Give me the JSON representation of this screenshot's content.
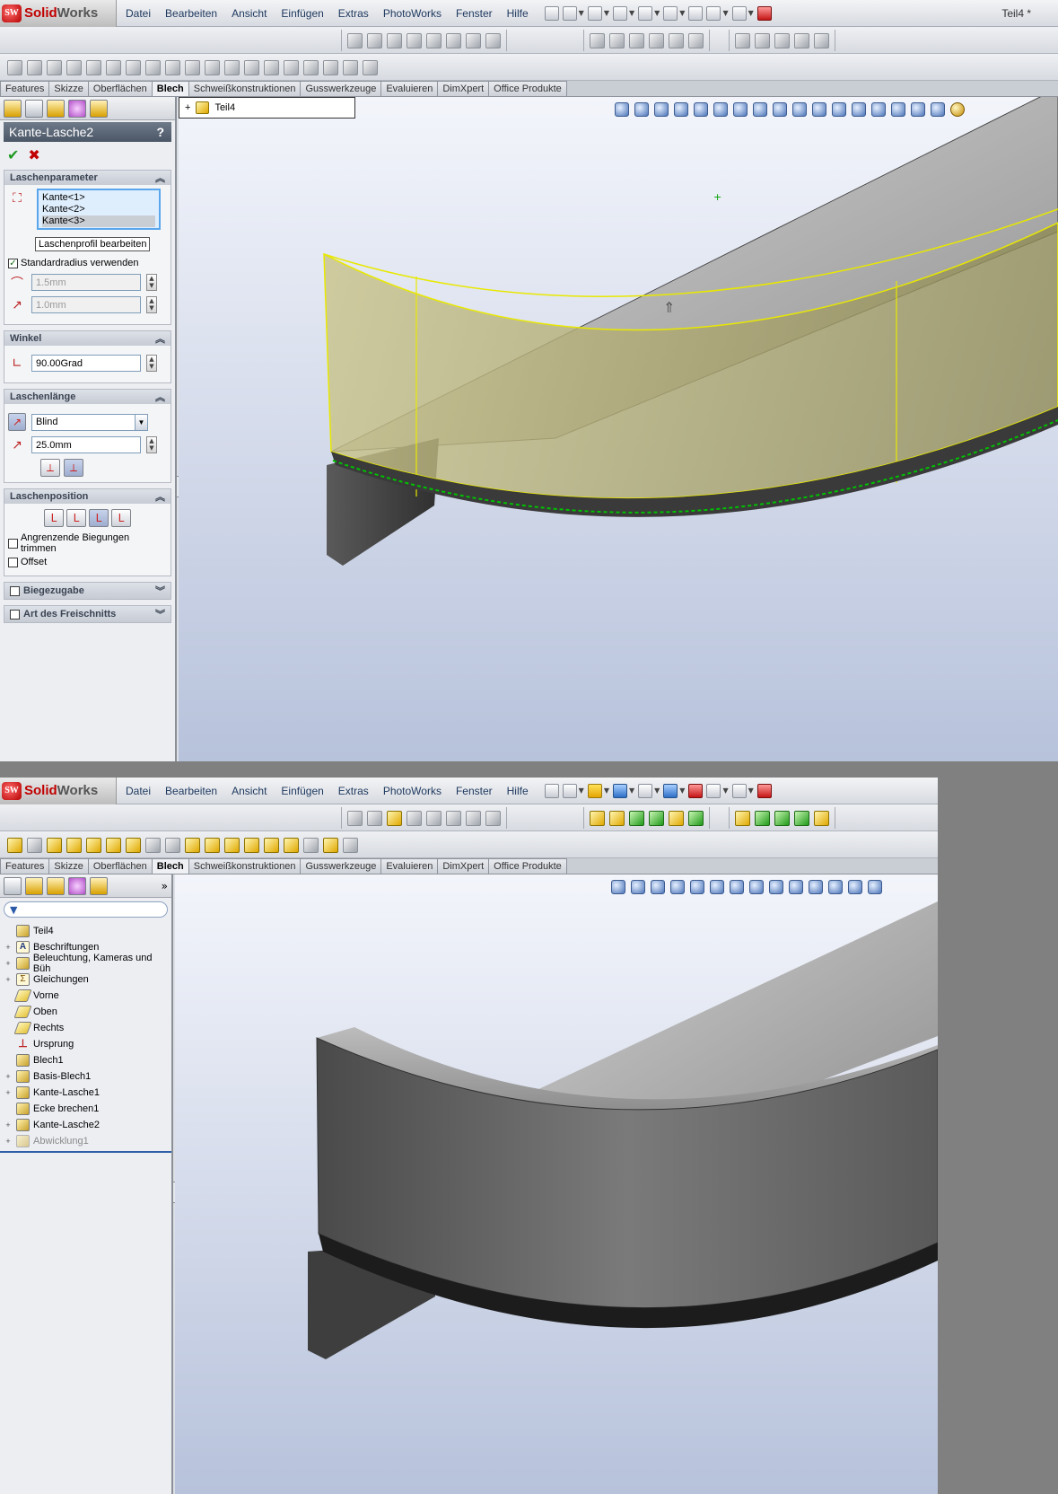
{
  "app": {
    "logo_text_red": "Solid",
    "logo_text_gray": "Works",
    "logo_mark": "SW",
    "doc_title": "Teil4 *"
  },
  "menu": [
    "Datei",
    "Bearbeiten",
    "Ansicht",
    "Einfügen",
    "Extras",
    "PhotoWorks",
    "Fenster",
    "Hilfe"
  ],
  "tabs": [
    "Features",
    "Skizze",
    "Oberflächen",
    "Blech",
    "Schweißkonstruktionen",
    "Gusswerkzeuge",
    "Evaluieren",
    "DimXpert",
    "Office Produkte"
  ],
  "active_tab": "Blech",
  "property_manager": {
    "title": "Kante-Lasche2",
    "help": "?",
    "ok_symbol": "✔",
    "cancel_symbol": "✖",
    "laschenparameter": {
      "header": "Laschenparameter",
      "edges": [
        "Kante<1>",
        "Kante<2>",
        "Kante<3>"
      ],
      "edit_profile_button": "Laschenprofil bearbeiten",
      "standard_radius_label": "Standardradius verwenden",
      "standard_radius_checked": true,
      "radius_value": "1.5mm",
      "gap_value": "1.0mm"
    },
    "winkel": {
      "header": "Winkel",
      "value": "90.00Grad"
    },
    "laschenlaenge": {
      "header": "Laschenlänge",
      "condition": "Blind",
      "length": "25.0mm"
    },
    "laschenposition": {
      "header": "Laschenposition",
      "trim_label": "Angrenzende Biegungen trimmen",
      "offset_label": "Offset"
    },
    "biegezugabe": "Biegezugabe",
    "freischnitt": "Art des Freischnitts"
  },
  "tree_top": {
    "root": "Teil4"
  },
  "feature_tree": {
    "filter_icon": "▼",
    "items": [
      {
        "label": "Teil4",
        "icon": "part",
        "expander": ""
      },
      {
        "label": "Beschriftungen",
        "icon": "annotations",
        "expander": "+"
      },
      {
        "label": "Beleuchtung, Kameras und Büh",
        "icon": "lights",
        "expander": "+"
      },
      {
        "label": "Gleichungen",
        "icon": "sigma",
        "expander": "+"
      },
      {
        "label": "Vorne",
        "icon": "plane",
        "expander": ""
      },
      {
        "label": "Oben",
        "icon": "plane",
        "expander": ""
      },
      {
        "label": "Rechts",
        "icon": "plane",
        "expander": ""
      },
      {
        "label": "Ursprung",
        "icon": "origin",
        "expander": ""
      },
      {
        "label": "Blech1",
        "icon": "sheet",
        "expander": ""
      },
      {
        "label": "Basis-Blech1",
        "icon": "sheet",
        "expander": "+"
      },
      {
        "label": "Kante-Lasche1",
        "icon": "sheet",
        "expander": "+"
      },
      {
        "label": "Ecke brechen1",
        "icon": "sheet",
        "expander": ""
      },
      {
        "label": "Kante-Lasche2",
        "icon": "sheet",
        "expander": "+"
      },
      {
        "label": "Abwicklung1",
        "icon": "flat",
        "expander": "+",
        "disabled": true
      }
    ]
  },
  "colors": {
    "accent_blue": "#2f5fa8",
    "preview_yellow": "#e8e800",
    "edge_green": "#00c000",
    "model_gray": "#8c8c8c"
  }
}
